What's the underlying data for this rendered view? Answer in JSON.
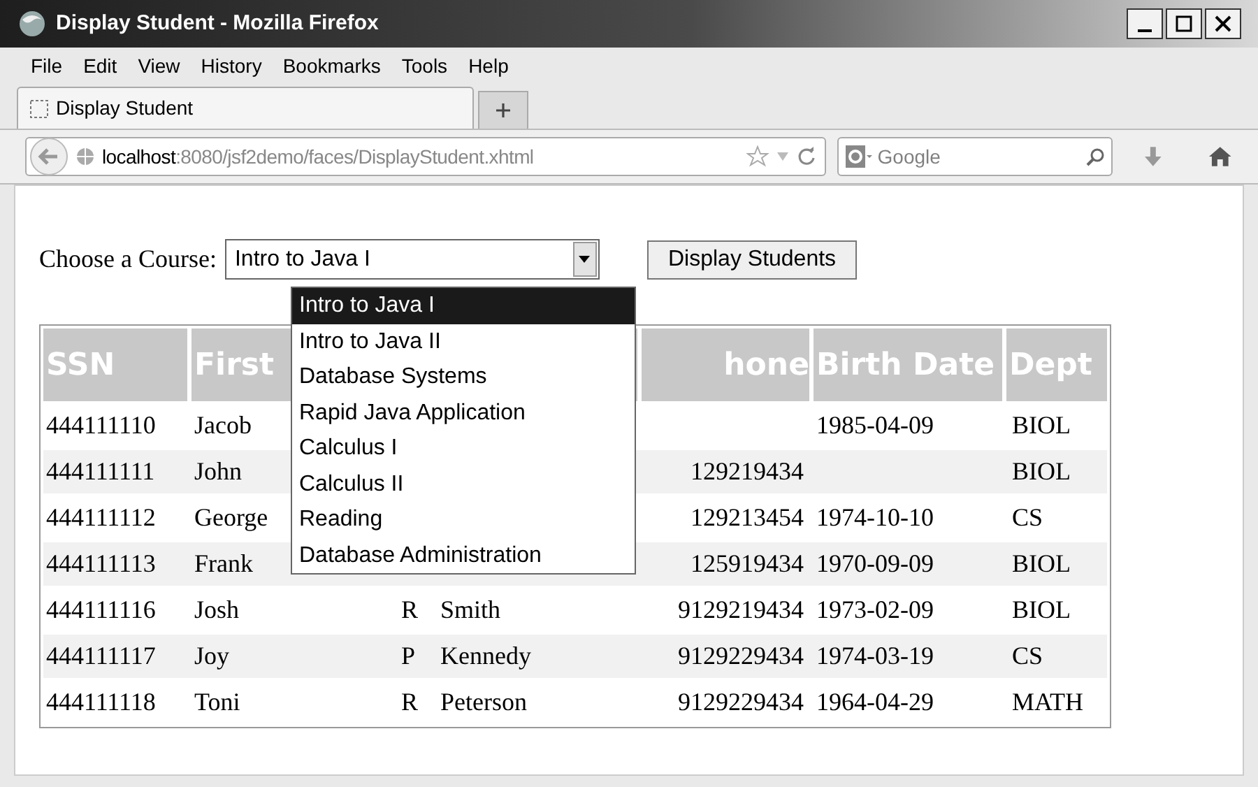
{
  "window": {
    "title": "Display Student - Mozilla Firefox"
  },
  "menu": [
    "File",
    "Edit",
    "View",
    "History",
    "Bookmarks",
    "Tools",
    "Help"
  ],
  "tab": {
    "label": "Display Student"
  },
  "address": {
    "host": "localhost",
    "path": ":8080/jsf2demo/faces/DisplayStudent.xhtml"
  },
  "search": {
    "placeholder": "Google"
  },
  "form": {
    "label": "Choose a Course:",
    "value": "Intro to Java I",
    "button": "Display Students",
    "options": [
      {
        "label": "Intro to Java I",
        "selected": true
      },
      {
        "label": "Intro to Java II",
        "selected": false
      },
      {
        "label": "Database Systems",
        "selected": false
      },
      {
        "label": "Rapid Java Application",
        "selected": false
      },
      {
        "label": "Calculus I",
        "selected": false
      },
      {
        "label": "Calculus II",
        "selected": false
      },
      {
        "label": "Reading",
        "selected": false
      },
      {
        "label": "Database Administration",
        "selected": false
      }
    ]
  },
  "table": {
    "columns": [
      "SSN",
      "First",
      null,
      null,
      "hone",
      "Birth Date",
      "Dept"
    ],
    "rows": [
      [
        "444111110",
        "Jacob",
        null,
        null,
        null,
        "1985-04-09",
        "BIOL"
      ],
      [
        "444111111",
        "John",
        null,
        null,
        "129219434",
        null,
        "BIOL"
      ],
      [
        "444111112",
        "George",
        null,
        null,
        "129213454",
        "1974-10-10",
        "CS"
      ],
      [
        "444111113",
        "Frank",
        null,
        null,
        "125919434",
        "1970-09-09",
        "BIOL"
      ],
      [
        "444111116",
        "Josh",
        "R",
        "Smith",
        "9129219434",
        "1973-02-09",
        "BIOL"
      ],
      [
        "444111117",
        "Joy",
        "P",
        "Kennedy",
        "9129229434",
        "1974-03-19",
        "CS"
      ],
      [
        "444111118",
        "Toni",
        "R",
        "Peterson",
        "9129229434",
        "1964-04-29",
        "MATH"
      ]
    ]
  }
}
